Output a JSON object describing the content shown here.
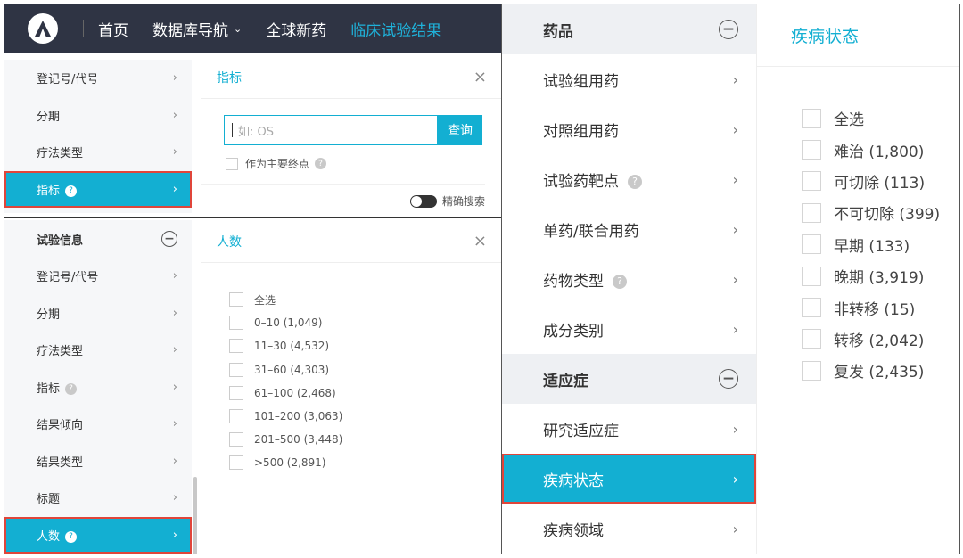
{
  "nav": {
    "items": [
      {
        "label": "首页"
      },
      {
        "label": "数据库导航"
      },
      {
        "label": "全球新药"
      },
      {
        "label": "临床试验结果"
      }
    ]
  },
  "menu_top": {
    "items": [
      {
        "label": "登记号/代号"
      },
      {
        "label": "分期"
      },
      {
        "label": "疗法类型"
      },
      {
        "label": "指标"
      }
    ]
  },
  "indicator_panel": {
    "title": "指标",
    "search_placeholder": "如: OS",
    "search_button": "查询",
    "primary_endpoint_label": "作为主要终点",
    "exact_search_label": "精确搜索"
  },
  "menu_bottom": {
    "header": "试验信息",
    "items": [
      {
        "label": "登记号/代号"
      },
      {
        "label": "分期"
      },
      {
        "label": "疗法类型"
      },
      {
        "label": "指标"
      },
      {
        "label": "结果倾向"
      },
      {
        "label": "结果类型"
      },
      {
        "label": "标题"
      },
      {
        "label": "人数"
      }
    ]
  },
  "count_panel": {
    "title": "人数",
    "options": [
      {
        "label": "全选"
      },
      {
        "label": "0–10 (1,049)"
      },
      {
        "label": "11–30 (4,532)"
      },
      {
        "label": "31–60 (4,303)"
      },
      {
        "label": "61–100 (2,468)"
      },
      {
        "label": "101–200 (3,063)"
      },
      {
        "label": "201–500 (3,448)"
      },
      {
        "label": ">500 (2,891)"
      }
    ]
  },
  "right_menu": {
    "drug_header": "药品",
    "drug_items": [
      {
        "label": "试验组用药"
      },
      {
        "label": "对照组用药"
      },
      {
        "label": "试验药靶点"
      },
      {
        "label": "单药/联合用药"
      },
      {
        "label": "药物类型"
      },
      {
        "label": "成分类别"
      }
    ],
    "indication_header": "适应症",
    "indication_items": [
      {
        "label": "研究适应症"
      },
      {
        "label": "疾病状态"
      },
      {
        "label": "疾病领域"
      }
    ]
  },
  "disease_status_panel": {
    "title": "疾病状态",
    "options": [
      {
        "label": "全选"
      },
      {
        "label": "难治 (1,800)"
      },
      {
        "label": "可切除 (113)"
      },
      {
        "label": "不可切除 (399)"
      },
      {
        "label": "早期 (133)"
      },
      {
        "label": "晚期 (3,919)"
      },
      {
        "label": "非转移 (15)"
      },
      {
        "label": "转移 (2,042)"
      },
      {
        "label": "复发 (2,435)"
      }
    ]
  },
  "colors": {
    "accent": "#13afd2",
    "highlight_border": "#e0453a",
    "nav_bg": "#2f3444"
  }
}
